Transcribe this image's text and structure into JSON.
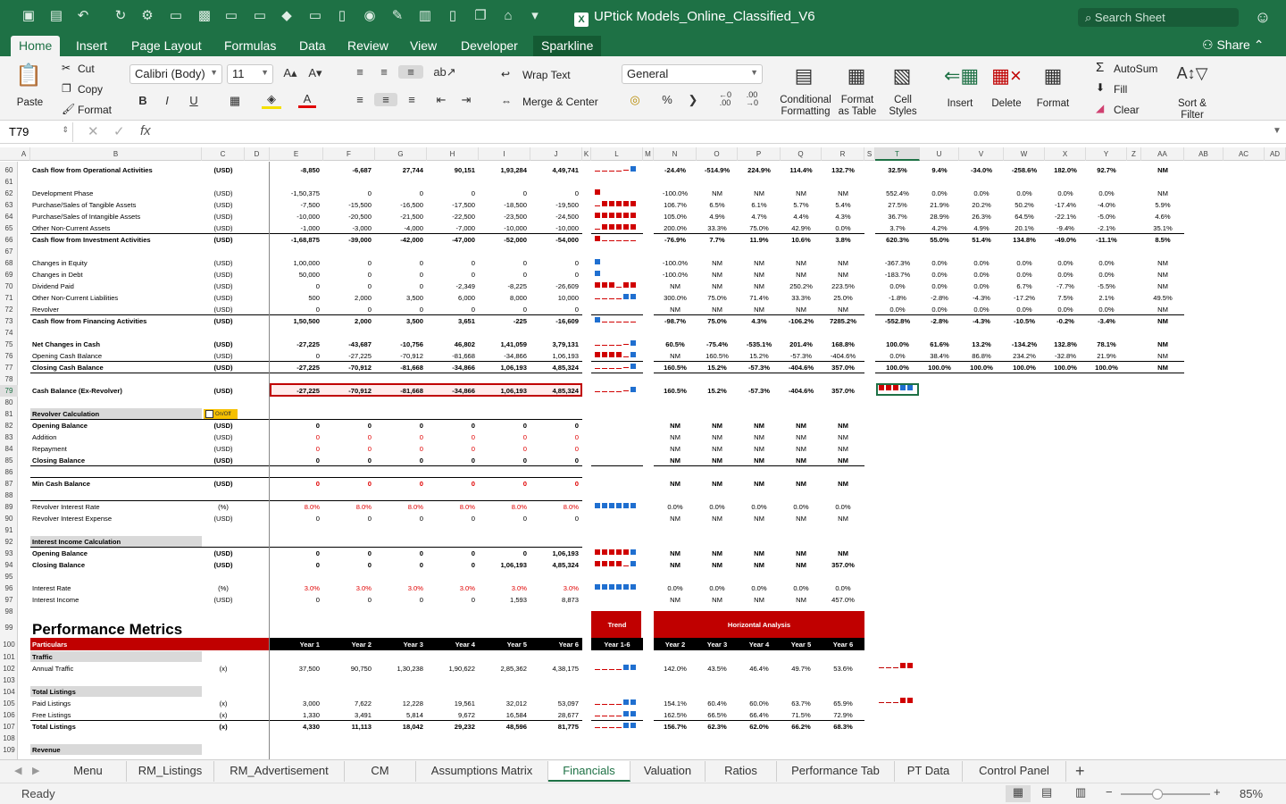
{
  "title": "UPtick Models_Online_Classified_V6",
  "search": {
    "placeholder": "Search Sheet"
  },
  "ribbon_tabs": [
    "Home",
    "Insert",
    "Page Layout",
    "Formulas",
    "Data",
    "Review",
    "View",
    "Developer",
    "Sparkline"
  ],
  "share_label": "Share",
  "clipboard": {
    "paste": "Paste",
    "cut": "Cut",
    "copy": "Copy",
    "format": "Format"
  },
  "font": {
    "name": "Calibri (Body)",
    "size": "11"
  },
  "alignment": {
    "wrap": "Wrap Text",
    "merge": "Merge & Center"
  },
  "number": {
    "format": "General"
  },
  "styles": {
    "conditional": "Conditional Formatting",
    "table": "Format as Table",
    "cell": "Cell Styles"
  },
  "cells": {
    "insert": "Insert",
    "delete": "Delete",
    "format": "Format"
  },
  "editing": {
    "autosum": "AutoSum",
    "fill": "Fill",
    "clear": "Clear",
    "sort": "Sort & Filter"
  },
  "name_box": "T79",
  "fx": "fx",
  "columns": [
    "A",
    "B",
    "C",
    "D",
    "E",
    "F",
    "G",
    "H",
    "I",
    "J",
    "K",
    "L",
    "M",
    "N",
    "O",
    "P",
    "Q",
    "R",
    "S",
    "T",
    "U",
    "V",
    "W",
    "X",
    "Y",
    "Z",
    "AA",
    "AB",
    "AC",
    "AD"
  ],
  "rows": [
    {
      "n": "60",
      "label": "Cash flow from Operational Activities",
      "unit": "(USD)",
      "bold": true,
      "vals": [
        "-8,850",
        "-6,687",
        "27,744",
        "90,151",
        "1,93,284",
        "4,49,741"
      ],
      "h": [
        "-24.4%",
        "-514.9%",
        "224.9%",
        "114.4%",
        "132.7%"
      ],
      "v": [
        "32.5%",
        "9.4%",
        "-34.0%",
        "-258.6%",
        "182.0%",
        "92.7%"
      ],
      "aa": "NM"
    },
    {
      "n": "61"
    },
    {
      "n": "62",
      "label": "Development Phase",
      "unit": "(USD)",
      "vals": [
        "-1,50,375",
        "0",
        "0",
        "0",
        "0",
        "0"
      ],
      "h": [
        "-100.0%",
        "NM",
        "NM",
        "NM",
        "NM"
      ],
      "v": [
        "552.4%",
        "0.0%",
        "0.0%",
        "0.0%",
        "0.0%",
        "0.0%"
      ],
      "aa": "NM"
    },
    {
      "n": "63",
      "label": "Purchase/Sales of Tangible Assets",
      "unit": "(USD)",
      "vals": [
        "-7,500",
        "-15,500",
        "-16,500",
        "-17,500",
        "-18,500",
        "-19,500"
      ],
      "h": [
        "106.7%",
        "6.5%",
        "6.1%",
        "5.7%",
        "5.4%"
      ],
      "v": [
        "27.5%",
        "21.9%",
        "20.2%",
        "50.2%",
        "-17.4%",
        "-4.0%"
      ],
      "aa": "5.9%"
    },
    {
      "n": "64",
      "label": "Purchase/Sales of Intangible Assets",
      "unit": "(USD)",
      "vals": [
        "-10,000",
        "-20,500",
        "-21,500",
        "-22,500",
        "-23,500",
        "-24,500"
      ],
      "h": [
        "105.0%",
        "4.9%",
        "4.7%",
        "4.4%",
        "4.3%"
      ],
      "v": [
        "36.7%",
        "28.9%",
        "26.3%",
        "64.5%",
        "-22.1%",
        "-5.0%"
      ],
      "aa": "4.6%"
    },
    {
      "n": "65",
      "label": "Other Non-Current Assets",
      "unit": "(USD)",
      "vals": [
        "-1,000",
        "-3,000",
        "-4,000",
        "-7,000",
        "-10,000",
        "-10,000"
      ],
      "h": [
        "200.0%",
        "33.3%",
        "75.0%",
        "42.9%",
        "0.0%"
      ],
      "v": [
        "3.7%",
        "4.2%",
        "4.9%",
        "20.1%",
        "-9.4%",
        "-2.1%"
      ],
      "aa": "35.1%"
    },
    {
      "n": "66",
      "label": "Cash flow from Investment Activities",
      "unit": "(USD)",
      "bold": true,
      "vals": [
        "-1,68,875",
        "-39,000",
        "-42,000",
        "-47,000",
        "-52,000",
        "-54,000"
      ],
      "h": [
        "-76.9%",
        "7.7%",
        "11.9%",
        "10.6%",
        "3.8%"
      ],
      "v": [
        "620.3%",
        "55.0%",
        "51.4%",
        "134.8%",
        "-49.0%",
        "-11.1%"
      ],
      "aa": "8.5%"
    },
    {
      "n": "67"
    },
    {
      "n": "68",
      "label": "Changes in Equity",
      "unit": "(USD)",
      "vals": [
        "1,00,000",
        "0",
        "0",
        "0",
        "0",
        "0"
      ],
      "h": [
        "-100.0%",
        "NM",
        "NM",
        "NM",
        "NM"
      ],
      "v": [
        "-367.3%",
        "0.0%",
        "0.0%",
        "0.0%",
        "0.0%",
        "0.0%"
      ],
      "aa": "NM"
    },
    {
      "n": "69",
      "label": "Changes in Debt",
      "unit": "(USD)",
      "vals": [
        "50,000",
        "0",
        "0",
        "0",
        "0",
        "0"
      ],
      "h": [
        "-100.0%",
        "NM",
        "NM",
        "NM",
        "NM"
      ],
      "v": [
        "-183.7%",
        "0.0%",
        "0.0%",
        "0.0%",
        "0.0%",
        "0.0%"
      ],
      "aa": "NM"
    },
    {
      "n": "70",
      "label": "Dividend Paid",
      "unit": "(USD)",
      "vals": [
        "0",
        "0",
        "0",
        "-2,349",
        "-8,225",
        "-26,609"
      ],
      "h": [
        "NM",
        "NM",
        "NM",
        "250.2%",
        "223.5%"
      ],
      "v": [
        "0.0%",
        "0.0%",
        "0.0%",
        "6.7%",
        "-7.7%",
        "-5.5%"
      ],
      "aa": "NM"
    },
    {
      "n": "71",
      "label": "Other Non-Current Liabilities",
      "unit": "(USD)",
      "vals": [
        "500",
        "2,000",
        "3,500",
        "6,000",
        "8,000",
        "10,000"
      ],
      "h": [
        "300.0%",
        "75.0%",
        "71.4%",
        "33.3%",
        "25.0%"
      ],
      "v": [
        "-1.8%",
        "-2.8%",
        "-4.3%",
        "-17.2%",
        "7.5%",
        "2.1%"
      ],
      "aa": "49.5%"
    },
    {
      "n": "72",
      "label": "Revolver",
      "unit": "(USD)",
      "vals": [
        "0",
        "0",
        "0",
        "0",
        "0",
        "0"
      ],
      "h": [
        "NM",
        "NM",
        "NM",
        "NM",
        "NM"
      ],
      "v": [
        "0.0%",
        "0.0%",
        "0.0%",
        "0.0%",
        "0.0%",
        "0.0%"
      ],
      "aa": "NM"
    },
    {
      "n": "73",
      "label": "Cash flow from Financing Activities",
      "unit": "(USD)",
      "bold": true,
      "vals": [
        "1,50,500",
        "2,000",
        "3,500",
        "3,651",
        "-225",
        "-16,609"
      ],
      "h": [
        "-98.7%",
        "75.0%",
        "4.3%",
        "-106.2%",
        "7285.2%"
      ],
      "v": [
        "-552.8%",
        "-2.8%",
        "-4.3%",
        "-10.5%",
        "-0.2%",
        "-3.4%"
      ],
      "aa": "NM"
    },
    {
      "n": "74"
    },
    {
      "n": "75",
      "label": "Net Changes in Cash",
      "unit": "(USD)",
      "bold": true,
      "vals": [
        "-27,225",
        "-43,687",
        "-10,756",
        "46,802",
        "1,41,059",
        "3,79,131"
      ],
      "h": [
        "60.5%",
        "-75.4%",
        "-535.1%",
        "201.4%",
        "168.8%"
      ],
      "v": [
        "100.0%",
        "61.6%",
        "13.2%",
        "-134.2%",
        "132.8%",
        "78.1%"
      ],
      "aa": "NM"
    },
    {
      "n": "76",
      "label": "Opening Cash Balance",
      "unit": "(USD)",
      "vals": [
        "0",
        "-27,225",
        "-70,912",
        "-81,668",
        "-34,866",
        "1,06,193"
      ],
      "h": [
        "NM",
        "160.5%",
        "15.2%",
        "-57.3%",
        "-404.6%"
      ],
      "v": [
        "0.0%",
        "38.4%",
        "86.8%",
        "234.2%",
        "-32.8%",
        "21.9%"
      ],
      "aa": "NM"
    },
    {
      "n": "77",
      "label": "Closing Cash Balance",
      "unit": "(USD)",
      "bold": true,
      "vals": [
        "-27,225",
        "-70,912",
        "-81,668",
        "-34,866",
        "1,06,193",
        "4,85,324"
      ],
      "h": [
        "160.5%",
        "15.2%",
        "-57.3%",
        "-404.6%",
        "357.0%"
      ],
      "v": [
        "100.0%",
        "100.0%",
        "100.0%",
        "100.0%",
        "100.0%",
        "100.0%"
      ],
      "aa": "NM"
    },
    {
      "n": "78"
    },
    {
      "n": "79",
      "label": "Cash Balance (Ex-Revolver)",
      "unit": "(USD)",
      "bold": true,
      "vals": [
        "-27,225",
        "-70,912",
        "-81,668",
        "-34,866",
        "1,06,193",
        "4,85,324"
      ],
      "h": [
        "160.5%",
        "15.2%",
        "-57.3%",
        "-404.6%",
        "357.0%"
      ]
    },
    {
      "n": "80"
    },
    {
      "n": "81",
      "label": "Revolver Calculation",
      "bold": true,
      "section": true,
      "toggle": "On/Off"
    },
    {
      "n": "82",
      "label": "Opening Balance",
      "unit": "(USD)",
      "bold": true,
      "vals": [
        "0",
        "0",
        "0",
        "0",
        "0",
        "0"
      ],
      "h": [
        "NM",
        "NM",
        "NM",
        "NM",
        "NM"
      ]
    },
    {
      "n": "83",
      "label": "Addition",
      "unit": "(USD)",
      "vals": [
        "0",
        "0",
        "0",
        "0",
        "0",
        "0"
      ],
      "red": true,
      "h": [
        "NM",
        "NM",
        "NM",
        "NM",
        "NM"
      ]
    },
    {
      "n": "84",
      "label": "Repayment",
      "unit": "(USD)",
      "vals": [
        "0",
        "0",
        "0",
        "0",
        "0",
        "0"
      ],
      "red": true,
      "h": [
        "NM",
        "NM",
        "NM",
        "NM",
        "NM"
      ]
    },
    {
      "n": "85",
      "label": "Closing Balance",
      "unit": "(USD)",
      "bold": true,
      "vals": [
        "0",
        "0",
        "0",
        "0",
        "0",
        "0"
      ],
      "h": [
        "NM",
        "NM",
        "NM",
        "NM",
        "NM"
      ]
    },
    {
      "n": "86"
    },
    {
      "n": "87",
      "label": "Min Cash Balance",
      "unit": "(USD)",
      "bold": true,
      "vals": [
        "0",
        "0",
        "0",
        "0",
        "0",
        "0"
      ],
      "red": true,
      "h": [
        "NM",
        "NM",
        "NM",
        "NM",
        "NM"
      ]
    },
    {
      "n": "88"
    },
    {
      "n": "89",
      "label": "Revolver Interest Rate",
      "unit": "(%)",
      "vals": [
        "8.0%",
        "8.0%",
        "8.0%",
        "8.0%",
        "8.0%",
        "8.0%"
      ],
      "red": true,
      "h": [
        "0.0%",
        "0.0%",
        "0.0%",
        "0.0%",
        "0.0%"
      ]
    },
    {
      "n": "90",
      "label": "Revolver Interest Expense",
      "unit": "(USD)",
      "vals": [
        "0",
        "0",
        "0",
        "0",
        "0",
        "0"
      ],
      "h": [
        "NM",
        "NM",
        "NM",
        "NM",
        "NM"
      ]
    },
    {
      "n": "91"
    },
    {
      "n": "92",
      "label": "Interest Income Calculation",
      "bold": true,
      "section": true
    },
    {
      "n": "93",
      "label": "Opening Balance",
      "unit": "(USD)",
      "bold": true,
      "vals": [
        "0",
        "0",
        "0",
        "0",
        "0",
        "1,06,193"
      ],
      "h": [
        "NM",
        "NM",
        "NM",
        "NM",
        "NM"
      ]
    },
    {
      "n": "94",
      "label": "Closing Balance",
      "unit": "(USD)",
      "bold": true,
      "vals": [
        "0",
        "0",
        "0",
        "0",
        "1,06,193",
        "4,85,324"
      ],
      "h": [
        "NM",
        "NM",
        "NM",
        "NM",
        "357.0%"
      ]
    },
    {
      "n": "95"
    },
    {
      "n": "96",
      "label": "Interest Rate",
      "unit": "(%)",
      "vals": [
        "3.0%",
        "3.0%",
        "3.0%",
        "3.0%",
        "3.0%",
        "3.0%"
      ],
      "red": true,
      "h": [
        "0.0%",
        "0.0%",
        "0.0%",
        "0.0%",
        "0.0%"
      ]
    },
    {
      "n": "97",
      "label": "Interest Income",
      "unit": "(USD)",
      "vals": [
        "0",
        "0",
        "0",
        "0",
        "1,593",
        "8,873"
      ],
      "h": [
        "NM",
        "NM",
        "NM",
        "NM",
        "457.0%"
      ]
    },
    {
      "n": "98"
    },
    {
      "n": "99",
      "big": "Performance Metrics",
      "trend": "Trend",
      "horiz": "Horizontal Analysis"
    },
    {
      "n": "100",
      "header": true,
      "label": "Particulars",
      "years": [
        "Year 1",
        "Year 2",
        "Year 3",
        "Year 4",
        "Year 5",
        "Year 6"
      ],
      "trendyr": "Year 1-6",
      "hyears": [
        "Year 2",
        "Year 3",
        "Year 4",
        "Year 5",
        "Year 6"
      ]
    },
    {
      "n": "101",
      "label": "Traffic",
      "bold": true,
      "section": true
    },
    {
      "n": "102",
      "label": "Annual Traffic",
      "unit": "(x)",
      "vals": [
        "37,500",
        "90,750",
        "1,30,238",
        "1,90,622",
        "2,85,362",
        "4,38,175"
      ],
      "h": [
        "142.0%",
        "43.5%",
        "46.4%",
        "49.7%",
        "53.6%"
      ]
    },
    {
      "n": "103"
    },
    {
      "n": "104",
      "label": "Total Listings",
      "bold": true,
      "section": true
    },
    {
      "n": "105",
      "label": "Paid Listings",
      "unit": "(x)",
      "vals": [
        "3,000",
        "7,622",
        "12,228",
        "19,561",
        "32,012",
        "53,097"
      ],
      "h": [
        "154.1%",
        "60.4%",
        "60.0%",
        "63.7%",
        "65.9%"
      ]
    },
    {
      "n": "106",
      "label": "Free Listings",
      "unit": "(x)",
      "vals": [
        "1,330",
        "3,491",
        "5,814",
        "9,672",
        "16,584",
        "28,677"
      ],
      "h": [
        "162.5%",
        "66.5%",
        "66.4%",
        "71.5%",
        "72.9%"
      ]
    },
    {
      "n": "107",
      "label": "Total Listings",
      "unit": "(x)",
      "bold": true,
      "vals": [
        "4,330",
        "11,113",
        "18,042",
        "29,232",
        "48,596",
        "81,775"
      ],
      "h": [
        "156.7%",
        "62.3%",
        "62.0%",
        "66.2%",
        "68.3%"
      ]
    },
    {
      "n": "108"
    },
    {
      "n": "109",
      "label": "Revenue",
      "bold": true,
      "section": true
    }
  ],
  "sheet_tabs": [
    "Menu",
    "RM_Listings",
    "RM_Advertisement",
    "CM",
    "Assumptions Matrix",
    "Financials",
    "Valuation",
    "Ratios",
    "Performance Tab",
    "PT Data",
    "Control Panel"
  ],
  "active_sheet": "Financials",
  "status": {
    "ready": "Ready",
    "zoom": "85%"
  },
  "colors": {
    "accent": "#1e7145",
    "header_dark": "#000000",
    "trend_red": "#c00000",
    "spark_blue": "#1f6fd0",
    "spark_red": "#d00000"
  }
}
